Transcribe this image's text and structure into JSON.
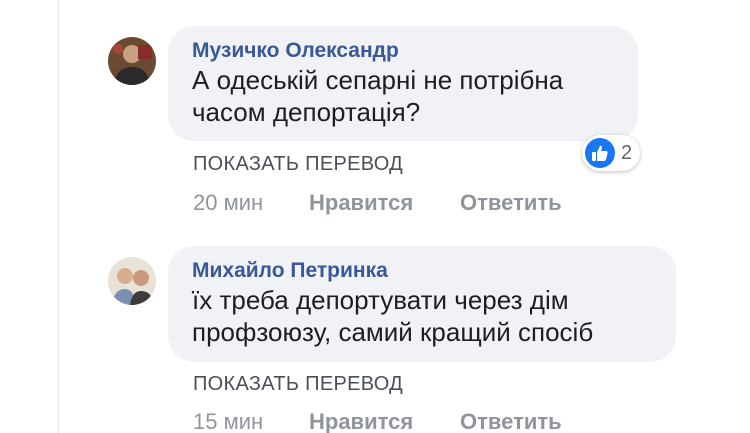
{
  "translate_label": "ПОКАЗАТЬ ПЕРЕВОД",
  "like_label": "Нравится",
  "reply_label": "Ответить",
  "comments": [
    {
      "author": "Музичко Олександр",
      "text": "А одеській сепарні не потрібна\nчасом депортація?",
      "time": "20 мин",
      "reactions": {
        "icon": "thumbs-up-icon",
        "count": "2"
      }
    },
    {
      "author": "Михайло Петринка",
      "text": "їх треба депортувати через дім\nпрофзоюзу, самий кращий спосіб",
      "time": "15 мин"
    }
  ],
  "colors": {
    "author": "#385898",
    "bubble": "#f0f2f5",
    "like_badge": "#1877f2"
  }
}
